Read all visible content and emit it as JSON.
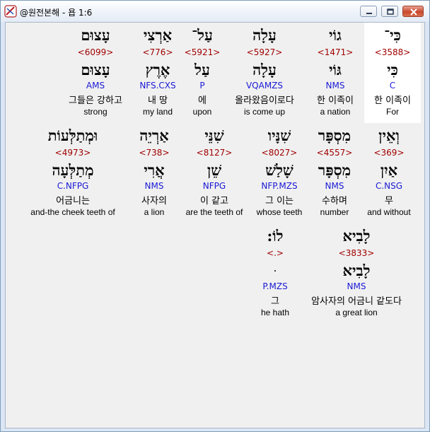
{
  "window": {
    "title": "@원전본해 - 욥 1:6",
    "colors": {
      "hebrew": "#000000",
      "strong": "#a00000",
      "morph": "#1a1ad6",
      "background": "#f0f0f0"
    }
  },
  "rows": [
    [
      {
        "hebrew": "כִּי־",
        "strong": "<3588>",
        "lemma": "כִּי",
        "morph": "C",
        "korean": "한 이족이",
        "english": "For",
        "selected": true
      },
      {
        "hebrew": "גוֹי",
        "strong": "<1471>",
        "lemma": "גּוֹי",
        "morph": "NMS",
        "korean": "한 이족이",
        "english": "a nation"
      },
      {
        "hebrew": "עָלָה",
        "strong": "<5927>",
        "lemma": "עָלָה",
        "morph": "VQAMZS",
        "korean": "올라왔음이로다",
        "english": "is come up"
      },
      {
        "hebrew": "עַל־",
        "strong": "<5921>",
        "lemma": "עַל",
        "morph": "P",
        "korean": "에",
        "english": "upon"
      },
      {
        "hebrew": "אַרְצִי",
        "strong": "<776>",
        "lemma": "אֶרֶץ",
        "morph": "NFS.CXS",
        "korean": "내 땅",
        "english": "my land"
      },
      {
        "hebrew": "עָצוּם",
        "strong": "<6099>",
        "lemma": "עָצוּם",
        "morph": "AMS",
        "korean": "그들은 강하고",
        "english": "strong"
      }
    ],
    [
      {
        "hebrew": "וְאֵין",
        "strong": "<369>",
        "lemma": "אַיִן",
        "morph": "C.NSG",
        "korean": "무",
        "english": "and without"
      },
      {
        "hebrew": "מִסְפָּר",
        "strong": "<4557>",
        "lemma": "מִסְפָּר",
        "morph": "NMS",
        "korean": "수하며",
        "english": "number"
      },
      {
        "hebrew": "שִׁנָּיו",
        "strong": "<8027>",
        "lemma": "שָׁלַשׁ",
        "morph": "NFP.MZS",
        "korean": "그 이는",
        "english": "whose teeth"
      },
      {
        "hebrew": "שִׁנֵּי",
        "strong": "<8127>",
        "lemma": "שֵׁן",
        "morph": "NFPG",
        "korean": "이 같고",
        "english": "are the teeth of"
      },
      {
        "hebrew": "אַרְיֵה",
        "strong": "<738>",
        "lemma": "אֲרִי",
        "morph": "NMS",
        "korean": "사자의",
        "english": "a lion"
      },
      {
        "hebrew": "וּמְתַלְּעוֹת",
        "strong": "<4973>",
        "lemma": "מְתַלְּעָה",
        "morph": "C.NFPG",
        "korean": "어금니는",
        "english": "and-the cheek teeth of"
      }
    ],
    [
      {
        "hebrew": "",
        "strong": "",
        "lemma": "",
        "morph": "",
        "korean": "",
        "english": ""
      },
      {
        "hebrew": "לָבִיא",
        "strong": "<3833>",
        "lemma": "לָבִיא",
        "morph": "NMS",
        "korean": "암사자의 어금니 같도다",
        "english": "a great lion"
      },
      {
        "hebrew": "לוֹ:",
        "strong": "<.>",
        "lemma": "ּ",
        "morph": "P.MZS",
        "korean": "그",
        "english": "he hath"
      }
    ]
  ]
}
